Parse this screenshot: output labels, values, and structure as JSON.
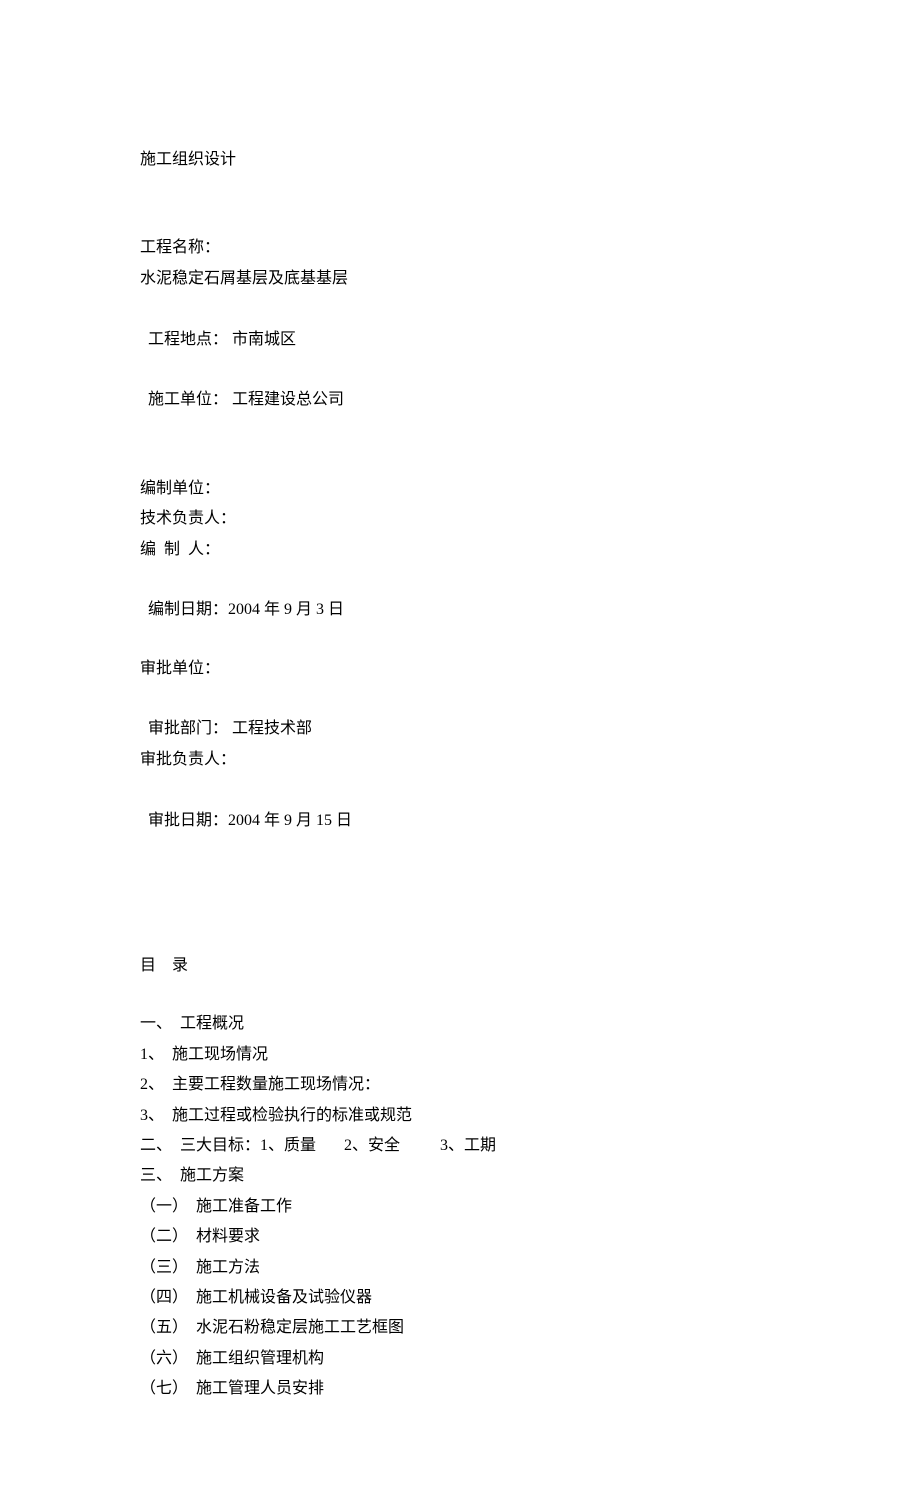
{
  "title": "施工组织设计",
  "project": {
    "name_label": "工程名称：",
    "name_value": "水泥稳定石屑基层及底基基层",
    "location_label": "工程地点：",
    "location_value": " 市南城区",
    "unit_label": "施工单位：",
    "unit_value": " 工程建设总公司"
  },
  "compilation": {
    "unit_label": "编制单位：",
    "tech_lead_label": "技术负责人：",
    "author_label": "编  制  人：",
    "date_label": "编制日期：",
    "date_value": "2004 年 9 月 3 日"
  },
  "approval": {
    "unit_label": "审批单位：",
    "dept_label": "审批部门：",
    "dept_value": " 工程技术部",
    "head_label": "审批负责人：",
    "date_label": "审批日期：",
    "date_value": "2004 年 9 月 15 日"
  },
  "toc": {
    "heading": "目    录",
    "items": [
      "一、  工程概况",
      "1、  施工现场情况",
      "2、  主要工程数量施工现场情况：",
      "3、  施工过程或检验执行的标准或规范",
      "二、  三大目标：1、质量       2、安全          3、工期",
      "三、  施工方案",
      "（一）  施工准备工作",
      "（二）  材料要求",
      "（三）  施工方法",
      "（四）  施工机械设备及试验仪器",
      "（五）  水泥石粉稳定层施工工艺框图",
      "（六）  施工组织管理机构",
      "（七）  施工管理人员安排"
    ]
  }
}
